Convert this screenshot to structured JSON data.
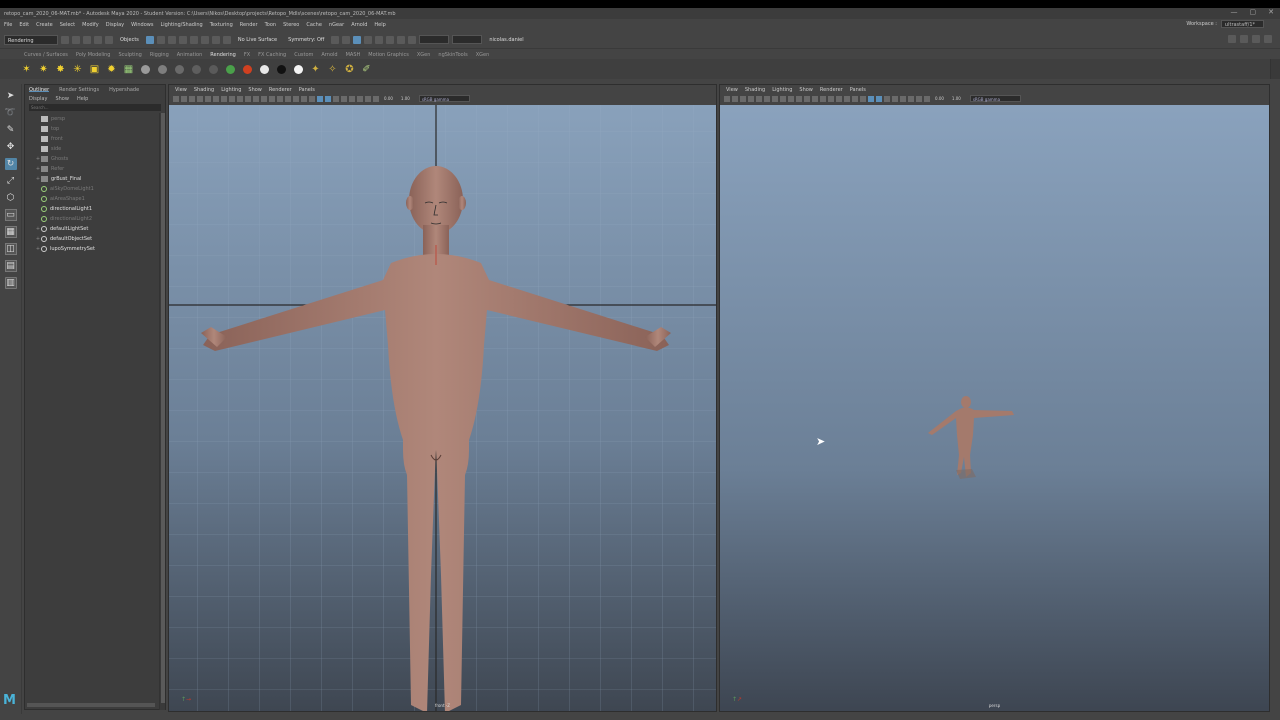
{
  "window": {
    "title": "retopo_cam_2020_06-MAT.mb* - Autodesk Maya 2020 - Student Version: C:\\Users\\Nikos\\Desktop\\projects\\Retopo_Mdls\\scenes\\retopo_cam_2020_06-MAT.mb",
    "controls": [
      "—",
      "▢",
      "✕"
    ]
  },
  "menubar": {
    "items": [
      "File",
      "Edit",
      "Create",
      "Select",
      "Modify",
      "Display",
      "Windows",
      "Lighting/Shading",
      "Texturing",
      "Render",
      "Toon",
      "Stereo",
      "Cache",
      "nGear",
      "Arnold",
      "Help"
    ],
    "workspace_label": "Workspace :",
    "workspace_value": "ultrastaff/1*"
  },
  "statusline": {
    "mode": "Rendering",
    "objects_label": "Objects",
    "live_surface": "No Live Surface",
    "symmetry": "Symmetry: Off",
    "user": "nicolas.daniel"
  },
  "shelf": {
    "tabs": [
      "Curves / Surfaces",
      "Poly Modeling",
      "Sculpting",
      "Rigging",
      "Animation",
      "Rendering",
      "FX",
      "FX Caching",
      "Custom",
      "Arnold",
      "MASH",
      "Motion Graphics",
      "XGen",
      "ngSkinTools",
      "XGen"
    ],
    "active_tab": "Rendering",
    "icons": [
      {
        "name": "sun-light-icon",
        "glyph": "✶",
        "color": "#f0d030"
      },
      {
        "name": "point-light-icon",
        "glyph": "✷",
        "color": "#f0d030"
      },
      {
        "name": "spot-light-icon",
        "glyph": "✸",
        "color": "#f0d030"
      },
      {
        "name": "area-light-icon",
        "glyph": "✳",
        "color": "#f0d030"
      },
      {
        "name": "volume-light-icon",
        "glyph": "▣",
        "color": "#f0d030"
      },
      {
        "name": "ambient-light-icon",
        "glyph": "✹",
        "color": "#f0d030"
      },
      {
        "name": "render-setup-icon",
        "glyph": "▦",
        "color": "#9ad07a"
      },
      {
        "name": "material-sphere-icon",
        "dot": "#9a9a9a"
      },
      {
        "name": "blinn-sphere-icon",
        "dot": "#7e7e7e"
      },
      {
        "name": "lambert-sphere-icon",
        "dot": "#6a6a6a"
      },
      {
        "name": "phong-sphere-icon",
        "dot": "#5e5e5e"
      },
      {
        "name": "shader-icon",
        "dot": "#5a5a5a"
      },
      {
        "name": "ramp-shader-icon",
        "dot": "#4aa04a"
      },
      {
        "name": "red-sphere-icon",
        "dot": "#d04020"
      },
      {
        "name": "white-sphere-icon",
        "dot": "#e8e8e8"
      },
      {
        "name": "black-sphere-icon",
        "dot": "#111111"
      },
      {
        "name": "light-sphere-icon",
        "dot": "#f4f4f4"
      },
      {
        "name": "render-view-icon",
        "glyph": "✦",
        "color": "#d0b040"
      },
      {
        "name": "ipr-render-icon",
        "glyph": "✧",
        "color": "#d0b040"
      },
      {
        "name": "render-settings-icon",
        "glyph": "✪",
        "color": "#d0b040"
      },
      {
        "name": "hypershade-icon",
        "glyph": "✐",
        "color": "#b0d080"
      }
    ]
  },
  "toolbox": {
    "tools": [
      "select-tool-icon",
      "lasso-tool-icon",
      "paint-tool-icon",
      "move-tool-icon",
      "rotate-tool-icon",
      "scale-tool-icon",
      "last-tool-icon",
      "single-view-icon",
      "four-view-icon",
      "two-view-icon",
      "outliner-layout-icon",
      "persp-outliner-icon"
    ]
  },
  "outliner": {
    "tabs": [
      "Outliner",
      "Render Settings",
      "Hypershade"
    ],
    "active_tab": "Outliner",
    "menu": [
      "Display",
      "Show",
      "Help"
    ],
    "search_placeholder": "Search...",
    "items": [
      {
        "label": "persp",
        "icon": "cam",
        "dim": true,
        "expander": ""
      },
      {
        "label": "top",
        "icon": "cam",
        "dim": true,
        "expander": ""
      },
      {
        "label": "front",
        "icon": "cam",
        "dim": true,
        "expander": ""
      },
      {
        "label": "side",
        "icon": "cam",
        "dim": true,
        "expander": ""
      },
      {
        "label": "Ghosts",
        "icon": "grp",
        "dim": true,
        "expander": "+"
      },
      {
        "label": "Refer",
        "icon": "grp",
        "dim": true,
        "expander": "+"
      },
      {
        "label": "grBust_Final",
        "icon": "grp",
        "dim": false,
        "expander": "+"
      },
      {
        "label": "aiSkyDomeLight1",
        "icon": "light",
        "dim": true,
        "expander": ""
      },
      {
        "label": "aiAreaShape1",
        "icon": "light",
        "dim": true,
        "expander": ""
      },
      {
        "label": "directionalLight1",
        "icon": "light",
        "dim": false,
        "expander": ""
      },
      {
        "label": "directionalLight2",
        "icon": "light",
        "dim": true,
        "expander": ""
      },
      {
        "label": "defaultLightSet",
        "icon": "set",
        "dim": false,
        "expander": "+"
      },
      {
        "label": "defaultObjectSet",
        "icon": "set",
        "dim": false,
        "expander": "+"
      },
      {
        "label": "lupoSymmetrySet",
        "icon": "set",
        "dim": false,
        "expander": "+"
      }
    ]
  },
  "panels": {
    "menu": [
      "View",
      "Shading",
      "Lighting",
      "Show",
      "Renderer",
      "Panels"
    ],
    "near": "0.00",
    "far": "1.00",
    "colorspace": "sRGB gamma",
    "left_label": "front -Z",
    "right_label": "persp"
  },
  "colors": {
    "accent": "#5285a6",
    "viewport_top": "#8aa2bd",
    "viewport_bottom": "#3d4551",
    "skin": "#a87a6c"
  }
}
